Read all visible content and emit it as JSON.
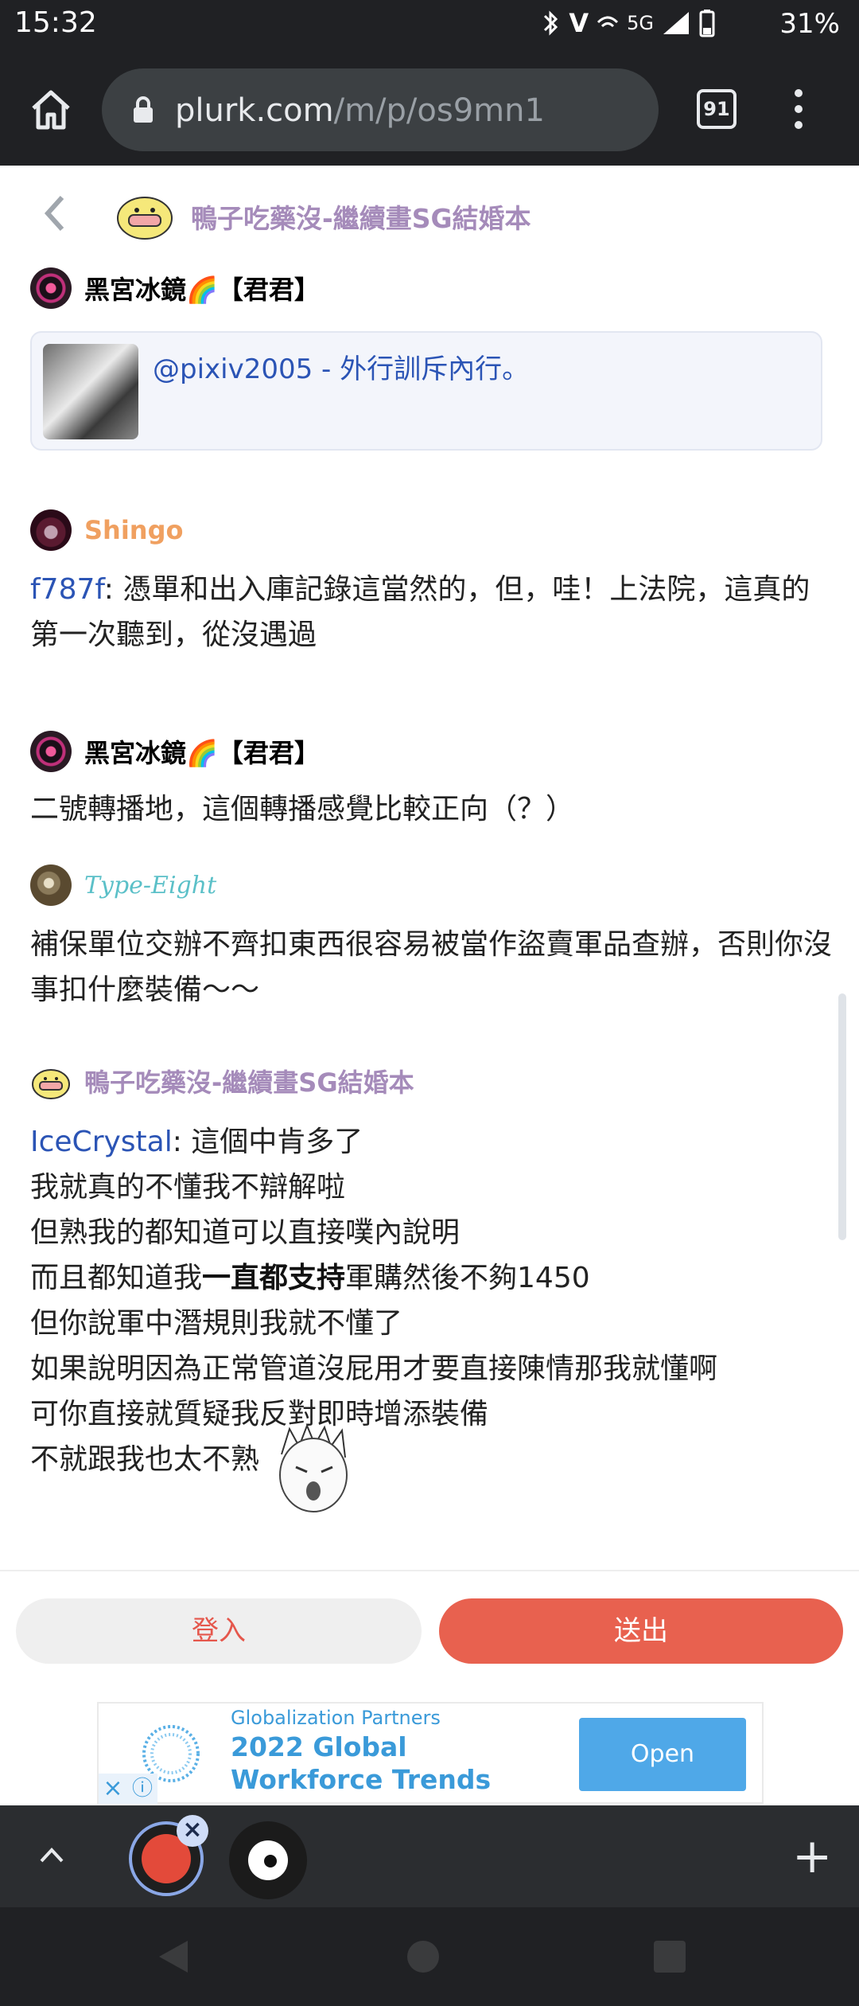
{
  "status_bar": {
    "time": "15:32",
    "network": "5G",
    "battery": "31%"
  },
  "browser": {
    "url_host": "plurk.com",
    "url_path": "/m/p/os9mn1",
    "tab_count": "91"
  },
  "plurk_header": {
    "owner_name": "鴨子吃藥沒-繼續畫SG結婚本"
  },
  "responses": [
    {
      "user": "黑宮冰鏡🌈【君君】",
      "quote_text": "@pixiv2005 - 外行訓斥內行。"
    },
    {
      "user": "Shingo",
      "mention": "f787f",
      "text": ": 憑單和出入庫記錄這當然的，但，哇！上法院，這真的第一次聽到，從沒遇過"
    },
    {
      "user": "黑宮冰鏡🌈【君君】",
      "text": "二號轉播地，這個轉播感覺比較正向（？）"
    },
    {
      "user": "Type-Eight",
      "text": "補保單位交辦不齊扣東西很容易被當作盜賣軍品查辦，否則你沒事扣什麼裝備～～"
    },
    {
      "user": "鴨子吃藥沒-繼續畫SG結婚本",
      "mention": "IceCrystal",
      "line1_rest": ": 這個中肯多了",
      "line2": "我就真的不懂我不辯解啦",
      "line3": "但熟我的都知道可以直接噗內說明",
      "line4_before": "而且都知道我",
      "line4_bold": "一直都支持",
      "line4_after": "軍購然後不夠1450",
      "line5": "但你說軍中潛規則我就不懂了",
      "line6": "如果說明因為正常管道沒屁用才要直接陳情那我就懂啊",
      "line7": "可你直接就質疑我反對即時增添裝備",
      "line8": "不就跟我也太不熟"
    }
  ],
  "actions": {
    "login": "登入",
    "send": "送出"
  },
  "ad": {
    "brand": "Globalization Partners",
    "title": "2022 Global Workforce Trends",
    "cta": "Open"
  },
  "colors": {
    "plurk_purple": "#a58bba",
    "shingo_orange": "#f0a060",
    "type_eight_teal": "#5bc0c8",
    "link_blue": "#2b54b5",
    "send_red": "#e8614f"
  }
}
